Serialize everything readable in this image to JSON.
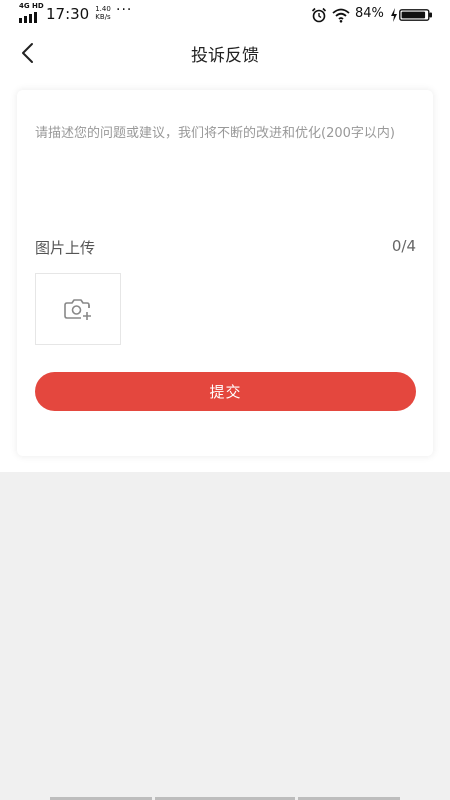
{
  "status_bar": {
    "network": "4G HD",
    "time": "17:30",
    "speed_value": "1.40",
    "speed_unit": "KB/s",
    "more": "···",
    "battery_percent": "84%",
    "icons": [
      "signal-icon",
      "alarm-icon",
      "wifi-icon",
      "charging-icon",
      "battery-icon"
    ]
  },
  "nav": {
    "back_icon": "chevron-left-icon",
    "title": "投诉反馈"
  },
  "form": {
    "feedback_value": "",
    "feedback_placeholder": "请描述您的问题或建议，我们将不断的改进和优化(200字以内)",
    "upload_label": "图片上传",
    "upload_count": "0/4",
    "upload_icon": "camera-add-icon",
    "submit_label": "提交"
  },
  "colors": {
    "accent": "#e4473e",
    "page_background": "#f0f0f0",
    "card_background": "#ffffff"
  }
}
